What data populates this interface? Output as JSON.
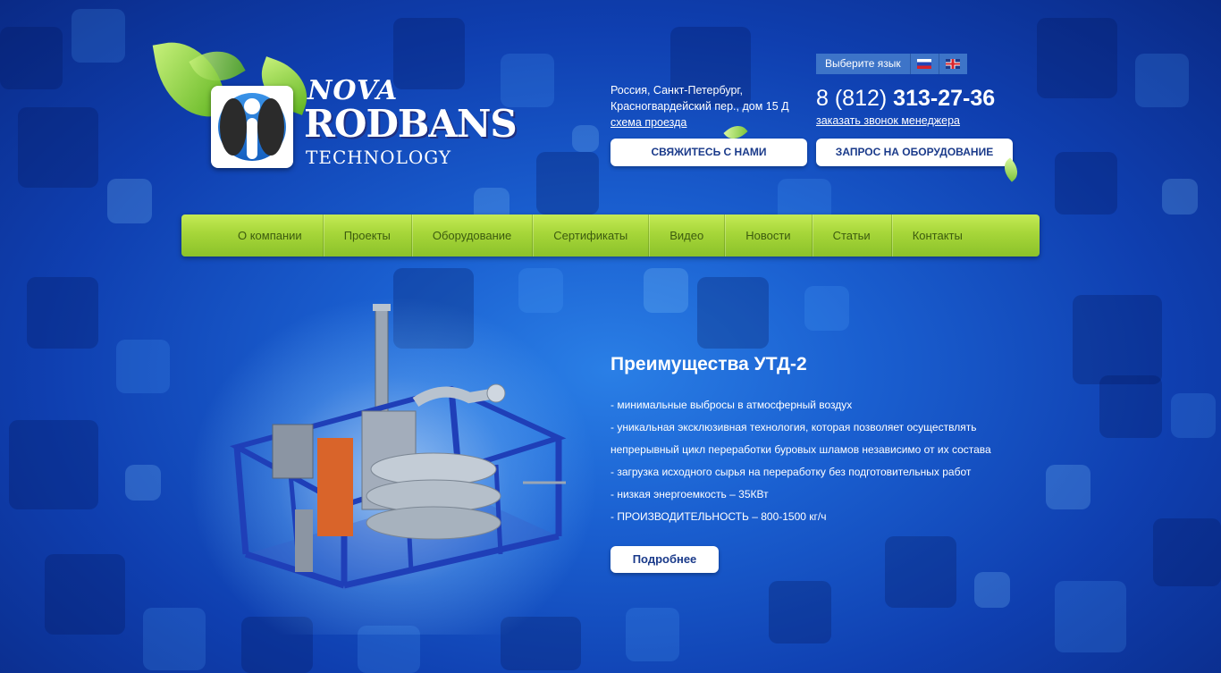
{
  "logo": {
    "nova": "NOVA",
    "rodbans": "RODBANS",
    "technology": "TECHNOLOGY"
  },
  "address": {
    "line1": "Россия, Санкт-Петербург,",
    "line2": "Красногвардейский пер., дом 15 Д",
    "link": "схема проезда"
  },
  "language": {
    "label": "Выберите язык",
    "options": [
      "ru-flag-icon",
      "en-flag-icon"
    ]
  },
  "phone": {
    "code": "8 (812)",
    "number": "313-27-36",
    "callback": "заказать звонок менеджера"
  },
  "buttons": {
    "contact": "СВЯЖИТЕСЬ С НАМИ",
    "request": "ЗАПРОС НА ОБОРУДОВАНИЕ"
  },
  "nav": [
    "О компании",
    "Проекты",
    "Оборудование",
    "Сертификаты",
    "Видео",
    "Новости",
    "Статьи",
    "Контакты"
  ],
  "hero": {
    "title": "Преимущества УТД-2",
    "features": [
      "-  минимальные выбросы в атмосферный воздух",
      "-  уникальная эксклюзивная технология, которая позволяет осуществлять",
      "непрерывный цикл переработки буровых шламов независимо от их состава",
      "-  загрузка исходного сырья на переработку без подготовительных работ",
      "-  низкая энергоемкость – 35КВт",
      "-  ПРОИЗВОДИТЕЛЬНОСТЬ – 800-1500 кг/ч"
    ],
    "more_button": "Подробнее"
  },
  "colors": {
    "background": "#1a5fd0",
    "nav_green": "#a6d639",
    "button_text": "#1a3a8a"
  }
}
